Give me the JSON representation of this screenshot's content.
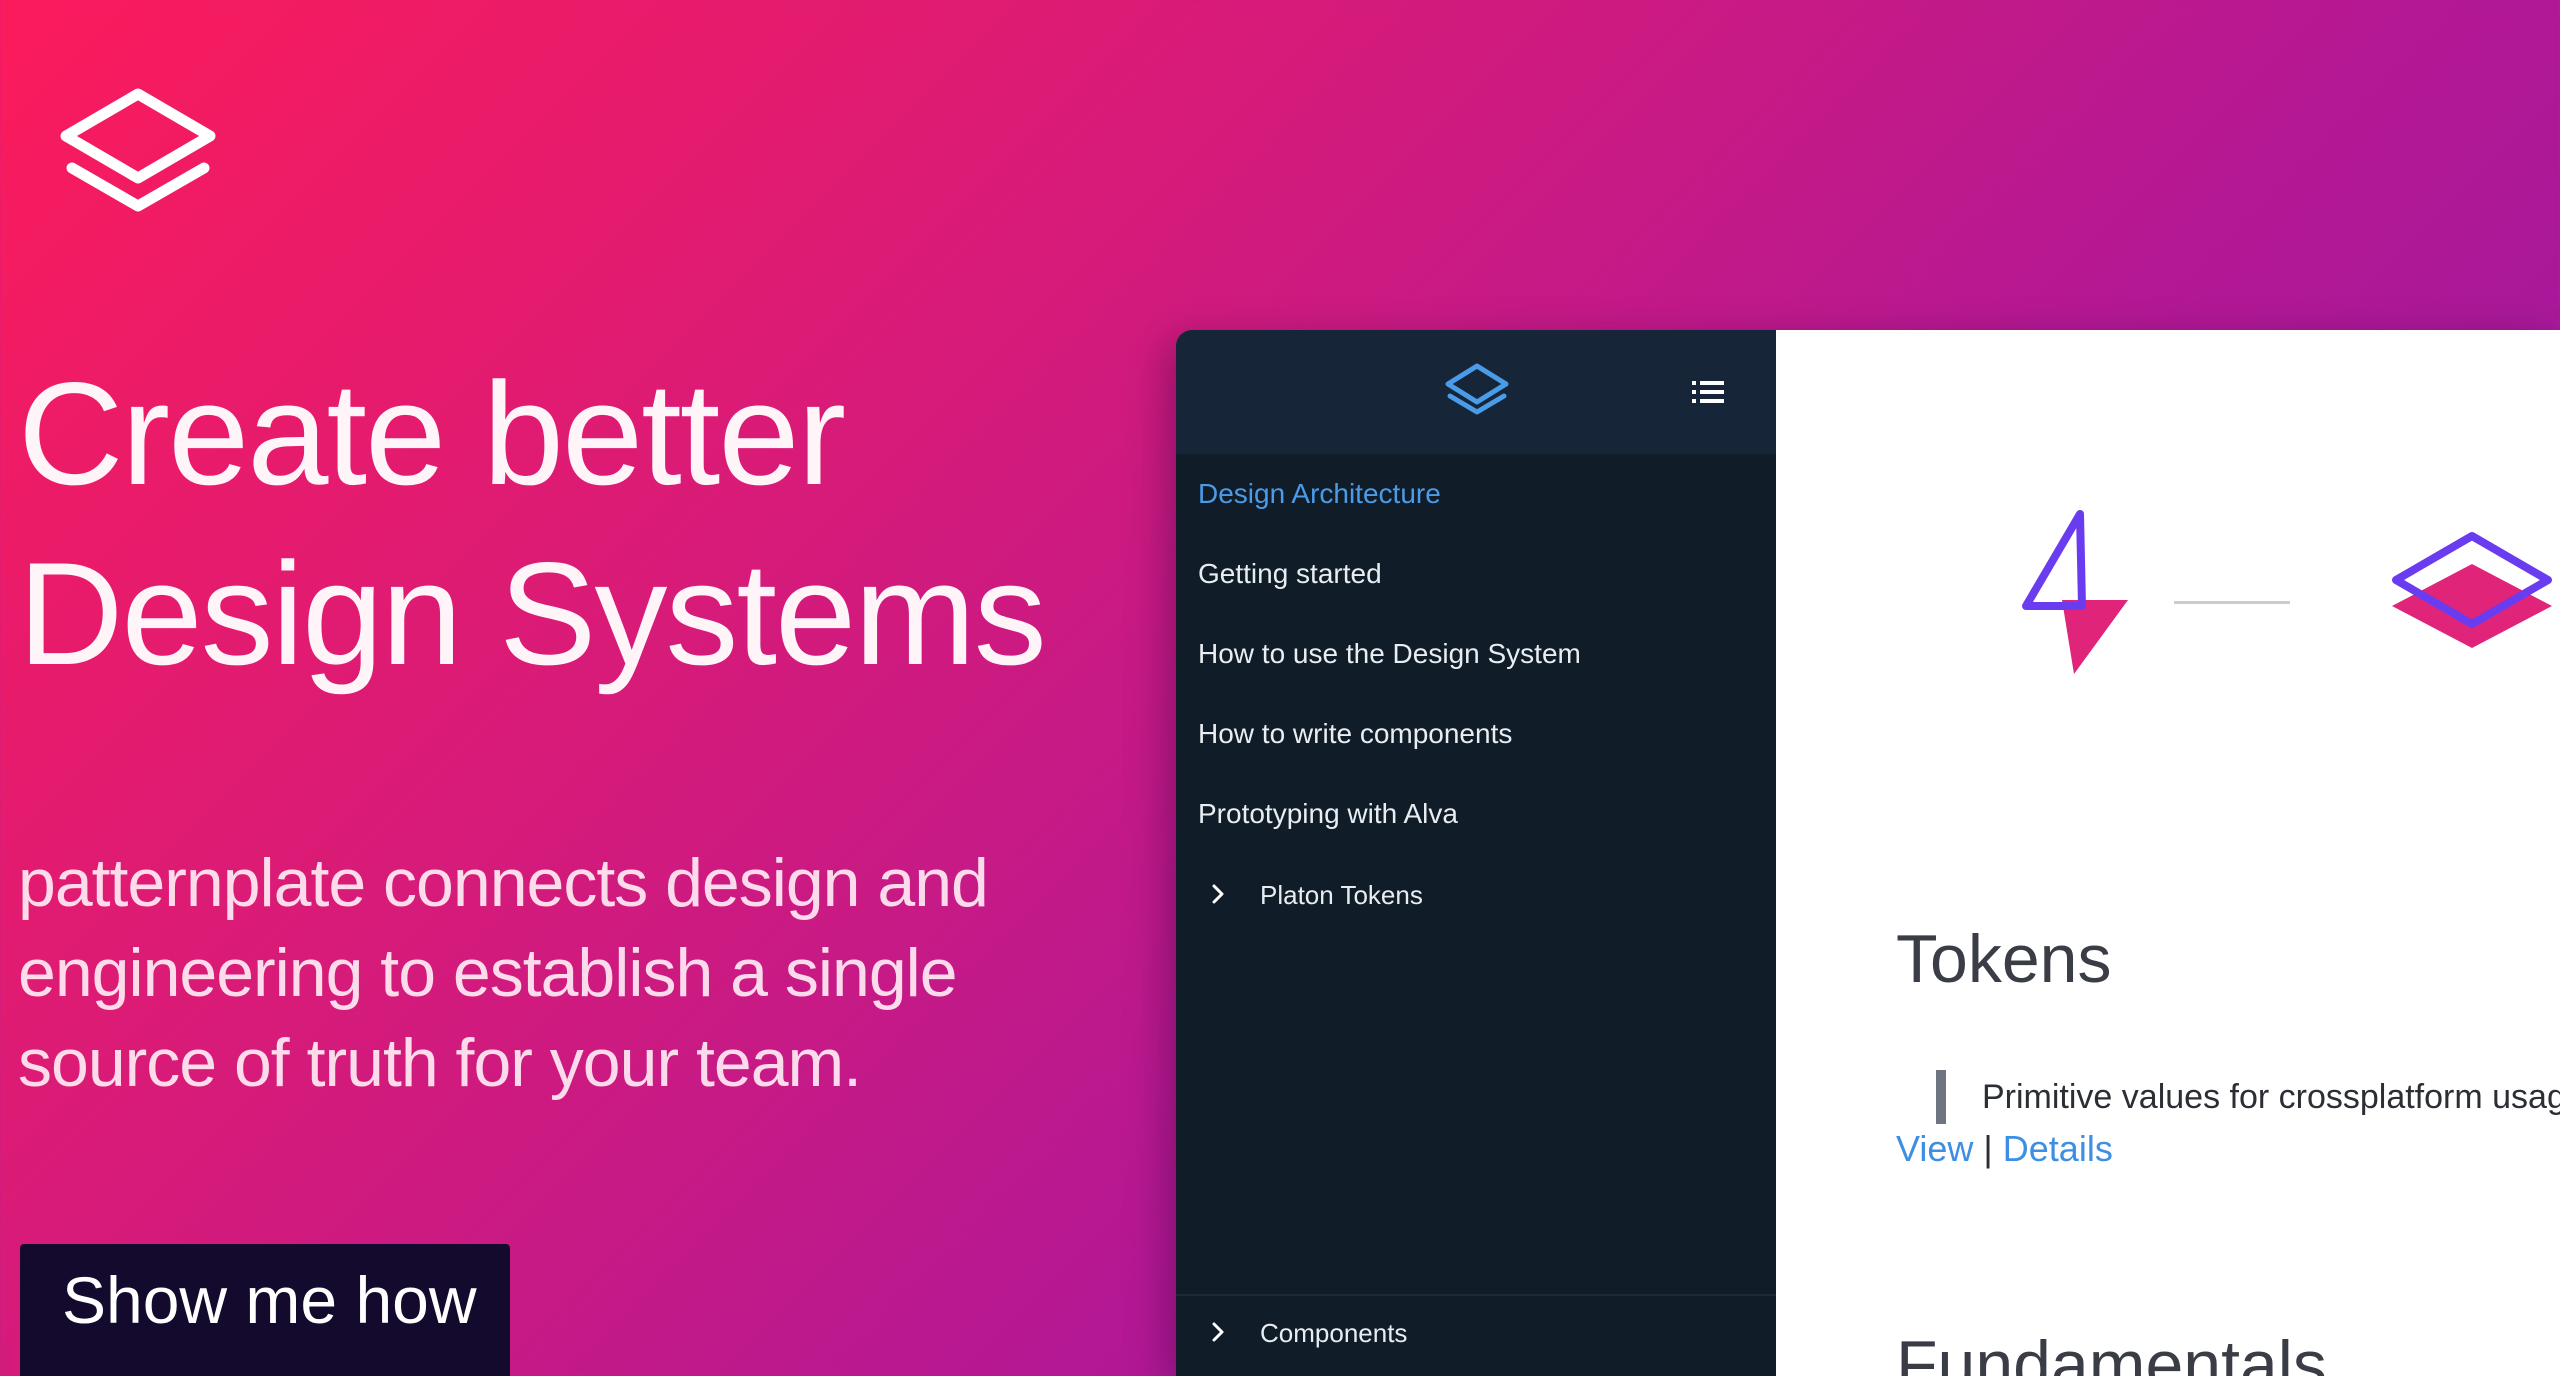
{
  "hero": {
    "logo_icon": "layers-logo-icon",
    "title_line1": "Create better",
    "title_line2": "Design Systems",
    "subtitle": "patternplate connects design and engineering to establish a single source of truth for your team.",
    "cta_label": "Show me how"
  },
  "colors": {
    "gradient_start": "#fb1b5b",
    "gradient_end": "#8e1aa6",
    "cta_background": "#140a2e",
    "sidebar_background": "#101c28",
    "sidebar_header": "#162538",
    "accent_blue": "#4a9be8",
    "accent_purple": "#6a3cf0",
    "accent_pink": "#e0247a"
  },
  "app": {
    "sidebar": {
      "logo_icon": "layers-logo-icon",
      "menu_icon": "list-menu-icon",
      "items": [
        {
          "label": "Design Architecture",
          "active": true
        },
        {
          "label": "Getting started"
        },
        {
          "label": "How to use the Design System"
        },
        {
          "label": "How to write components"
        },
        {
          "label": "Prototyping with Alva"
        }
      ],
      "groups": [
        {
          "label": "Platon Tokens",
          "icon": "chevron-right-icon"
        },
        {
          "label": "Components",
          "icon": "chevron-right-icon"
        }
      ]
    },
    "content": {
      "illustration_icons": [
        "lightning-bolt-icon",
        "layers-icon"
      ],
      "tokens_heading": "Tokens",
      "tokens_description": "Primitive values for crossplatform usag",
      "view_link": "View",
      "separator": "|",
      "details_link": "Details",
      "fundamentals_heading": "Fundamentals"
    }
  }
}
